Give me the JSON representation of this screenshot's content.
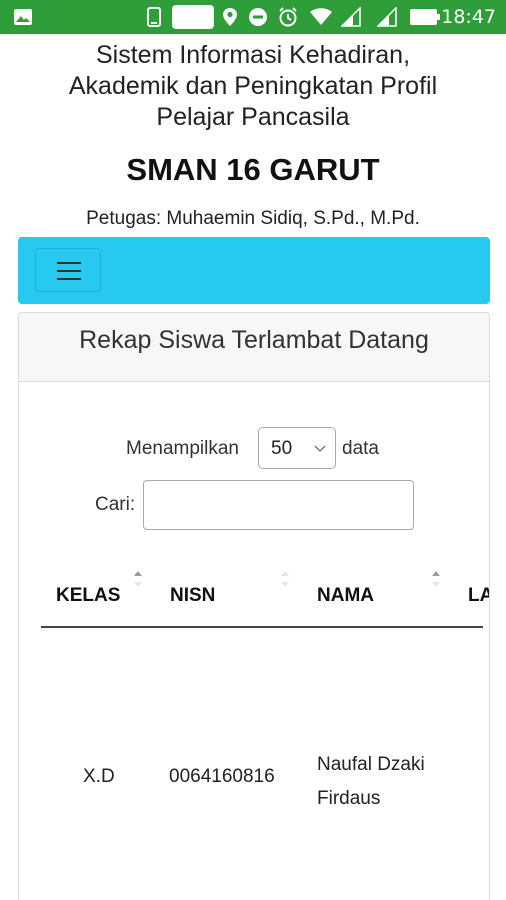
{
  "statusbar": {
    "time": "18:47",
    "battery_percent": "100%",
    "icons": [
      "image-icon",
      "phone-icon",
      "location-icon",
      "do-not-disturb-icon",
      "alarm-icon",
      "wifi-icon",
      "signal-icon",
      "signal-icon",
      "battery-icon"
    ]
  },
  "header": {
    "title_line1": "Sistem Informasi Kehadiran,",
    "title_line2": "Akademik dan Peningkatan Profil",
    "title_line3": "Pelajar Pancasila",
    "school": "SMAN 16 GARUT",
    "officer": "Petugas: Muhaemin Sidiq, S.Pd., M.Pd."
  },
  "navbar": {
    "color": "#27c9f0",
    "toggler_icon": "hamburger-icon"
  },
  "card": {
    "title": "Rekap Siswa Terlambat Datang",
    "length_label": "Menampilkan",
    "length_value": "50",
    "length_suffix": "data",
    "search_label": "Cari:",
    "search_value": ""
  },
  "table": {
    "columns": [
      "KELAS",
      "NISN",
      "NAMA",
      "LA"
    ],
    "rows": [
      {
        "kelas": "X.D",
        "nisn": "0064160816",
        "nama_line1": "Naufal Dzaki",
        "nama_line2": "Firdaus"
      }
    ]
  },
  "colors": {
    "statusbar": "#2f9e3a",
    "navbar": "#27c9f0"
  }
}
